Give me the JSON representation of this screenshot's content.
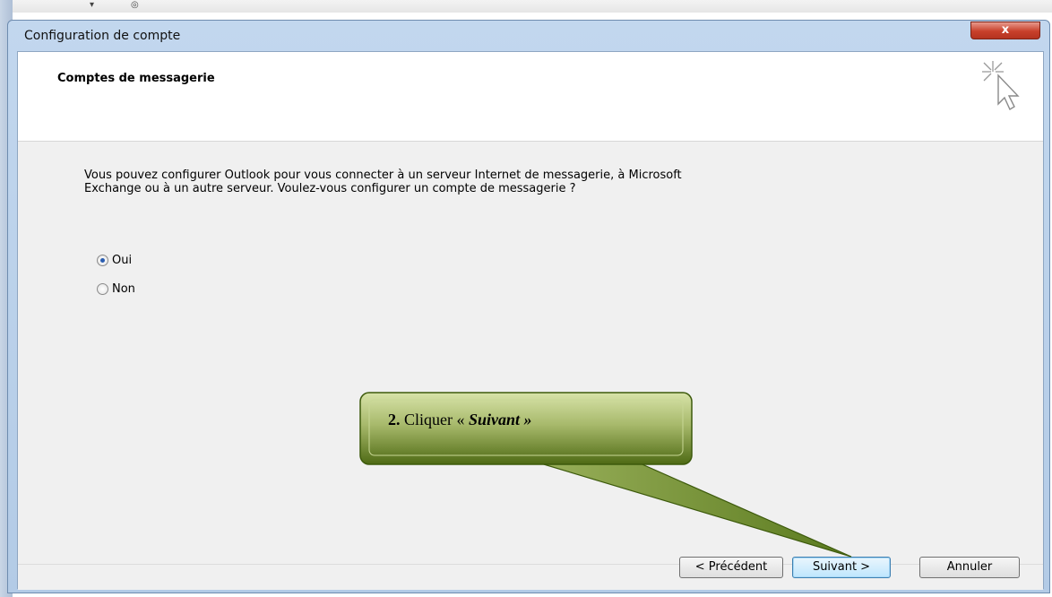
{
  "window": {
    "title": "Configuration de compte",
    "close_label": "x"
  },
  "header": {
    "title": "Comptes de messagerie",
    "icon": "cursor-sparkle-icon"
  },
  "content": {
    "intro": "Vous pouvez configurer Outlook pour vous connecter à un serveur Internet de messagerie, à Microsoft Exchange ou à un autre serveur. Voulez-vous configurer un compte de messagerie ?",
    "options": [
      {
        "label": "Oui",
        "checked": true
      },
      {
        "label": "Non",
        "checked": false
      }
    ]
  },
  "buttons": {
    "previous": "< Précédent",
    "next": "Suivant >",
    "cancel": "Annuler"
  },
  "callout": {
    "step": "2.",
    "text": "Cliquer «",
    "emphasis": "Suivant »",
    "fill_color": "#5a7a1e"
  }
}
